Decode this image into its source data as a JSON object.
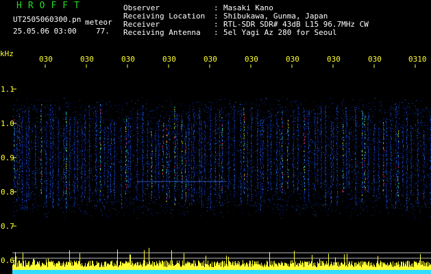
{
  "header": {
    "app_title": "HROFFT",
    "file_name": "UT2505060300.pn",
    "file_type": "meteor",
    "timestamp": "25.05.06 03:00",
    "count": "77."
  },
  "info": [
    {
      "label": "Observer",
      "value": "Masaki Kano"
    },
    {
      "label": "Receiving Location",
      "value": "Shibukawa, Gunma, Japan"
    },
    {
      "label": "Receiver",
      "value": "RTL-SDR SDR# 43dB L15 96.7MHz CW"
    },
    {
      "label": "Receiving Antenna",
      "value": "5el Yagi Az 280 for Seoul"
    }
  ],
  "axis": {
    "unit": "kHz",
    "y_ticks": [
      "1.1",
      "1.0",
      "0.9",
      "0.8",
      "0.7",
      "0.6"
    ],
    "x_ticks": [
      "030",
      "030",
      "030",
      "030",
      "030",
      "030",
      "030",
      "030",
      "030",
      "0310"
    ]
  },
  "colors": {
    "background": "#000000",
    "text": "#ffffff",
    "accent": "#ffff33",
    "title": "#22dd22",
    "cyan": "#33ddff"
  }
}
